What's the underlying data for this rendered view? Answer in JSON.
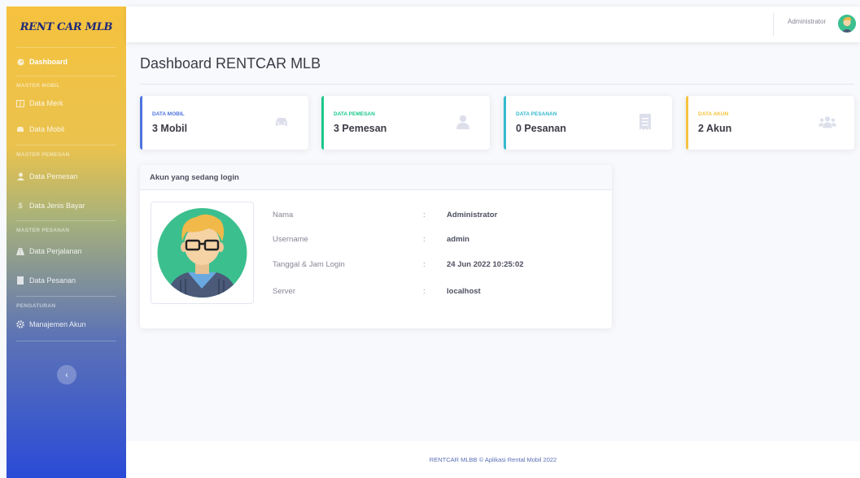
{
  "brand": "RENT CAR MLB",
  "sidebar": {
    "dashboard": "Dashboard",
    "headings": [
      "MASTER MOBIL",
      "MASTER PEMESAN",
      "MASTER PESANAN",
      "PENGATURAN"
    ],
    "items": [
      "Data Merk",
      "Data Mobil",
      "Data Pemesan",
      "Data Jenis Bayar",
      "Data Perjalanan",
      "Data Pesanan",
      "Manajemen Akun"
    ],
    "toggle_icon": "chevron-left-icon"
  },
  "topbar": {
    "user_name": "Administrator"
  },
  "page": {
    "title": "Dashboard RENTCAR MLB"
  },
  "cards": [
    {
      "label": "DATA MOBIL",
      "value": "3 Mobil",
      "color": "#4e73df",
      "icon": "car-icon"
    },
    {
      "label": "DATA PEMESAN",
      "value": "3 Pemesan",
      "color": "#1cc88a",
      "icon": "user-icon"
    },
    {
      "label": "DATA PESANAN",
      "value": "0 Pesanan",
      "color": "#36b9cc",
      "icon": "receipt-icon"
    },
    {
      "label": "DATA AKUN",
      "value": "2 Akun",
      "color": "#f6c23e",
      "icon": "users-icon"
    }
  ],
  "login_panel": {
    "title": "Akun yang sedang login",
    "rows": [
      {
        "label": "Nama",
        "value": "Administrator"
      },
      {
        "label": "Username",
        "value": "admin"
      },
      {
        "label": "Tanggal & Jam Login",
        "value": "24 Jun 2022 10:25:02"
      },
      {
        "label": "Server",
        "value": "localhost"
      }
    ],
    "colon": ":"
  },
  "footer": {
    "text": "RENTCAR MLBB © Aplikasi Rental Mobil 2022"
  }
}
